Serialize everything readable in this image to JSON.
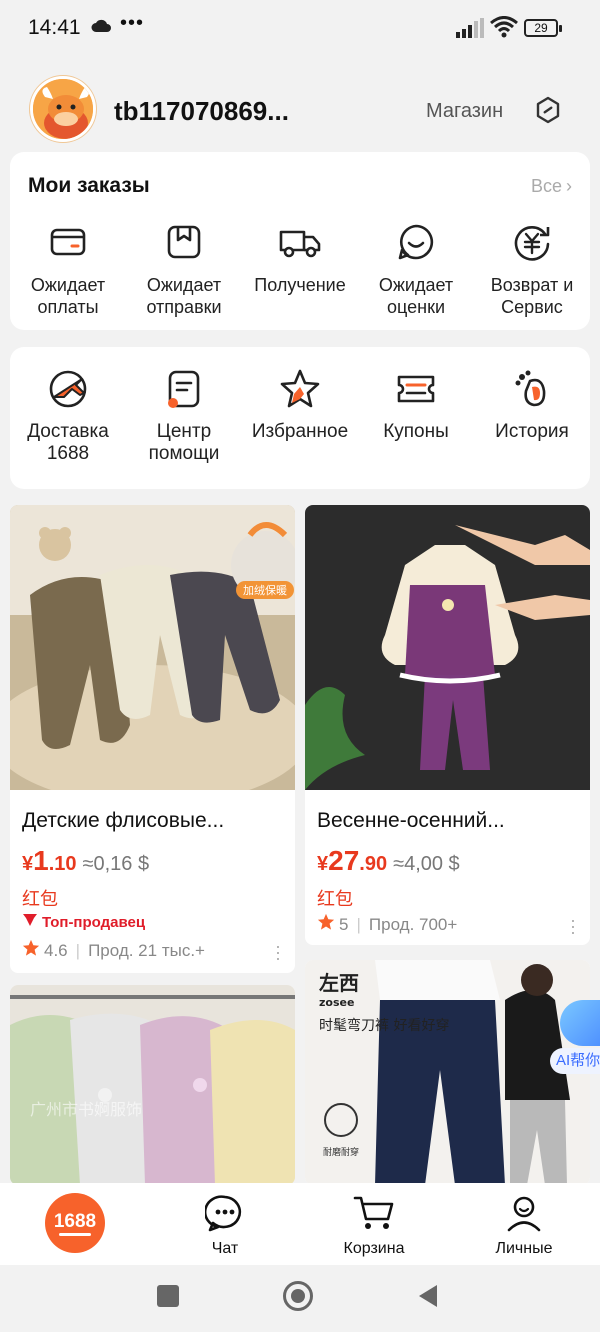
{
  "status_bar": {
    "time": "14:41",
    "dots": "•••",
    "battery": "29"
  },
  "header": {
    "username": "tb117070869...",
    "shop": "Магазин"
  },
  "orders": {
    "title": "Мои заказы",
    "all": "Все",
    "items": [
      {
        "label": "Ожидает оплаты",
        "icon": "wallet-icon"
      },
      {
        "label": "Ожидает отправки",
        "icon": "package-icon"
      },
      {
        "label": "Получение",
        "icon": "truck-icon"
      },
      {
        "label": "Ожидает оценки",
        "icon": "smile-icon"
      },
      {
        "label": "Возврат и Сервис",
        "icon": "refund-icon"
      }
    ]
  },
  "services": {
    "items": [
      {
        "label": "Доставка 1688",
        "icon": "plane-icon"
      },
      {
        "label": "Центр помощи",
        "icon": "help-doc-icon"
      },
      {
        "label": "Избранное",
        "icon": "star-icon"
      },
      {
        "label": "Купоны",
        "icon": "coupon-icon"
      },
      {
        "label": "История",
        "icon": "footprint-icon"
      }
    ]
  },
  "products": [
    {
      "title": "Детские флисовые...",
      "currency": "¥",
      "price_int": "1",
      "price_dec": ".10",
      "usd": "≈0,16 $",
      "tag": "红包",
      "top_seller": "Топ-продавец",
      "rating": "4.6",
      "sales": "Прод. 21 тыс.+",
      "image_text": "加绒保暖"
    },
    {
      "title": "Весенне-осенний...",
      "currency": "¥",
      "price_int": "27",
      "price_dec": ".90",
      "usd": "≈4,00 $",
      "tag": "红包",
      "rating": "5",
      "sales": "Прод. 700+"
    },
    {
      "watermark": "广州市书婀服饰"
    },
    {
      "brand": "左西",
      "brand_sub": "zosee",
      "slogan": "时髦弯刀裤 好看好穿",
      "badge": "耐磨耐穿"
    }
  ],
  "ai_helper": {
    "label": "AI帮你"
  },
  "bottom_nav": {
    "home": "1688",
    "chat": "Чат",
    "cart": "Корзина",
    "profile": "Личные"
  },
  "colors": {
    "accent": "#f7622b",
    "price": "#e8391e",
    "background": "#f2f2f2"
  }
}
